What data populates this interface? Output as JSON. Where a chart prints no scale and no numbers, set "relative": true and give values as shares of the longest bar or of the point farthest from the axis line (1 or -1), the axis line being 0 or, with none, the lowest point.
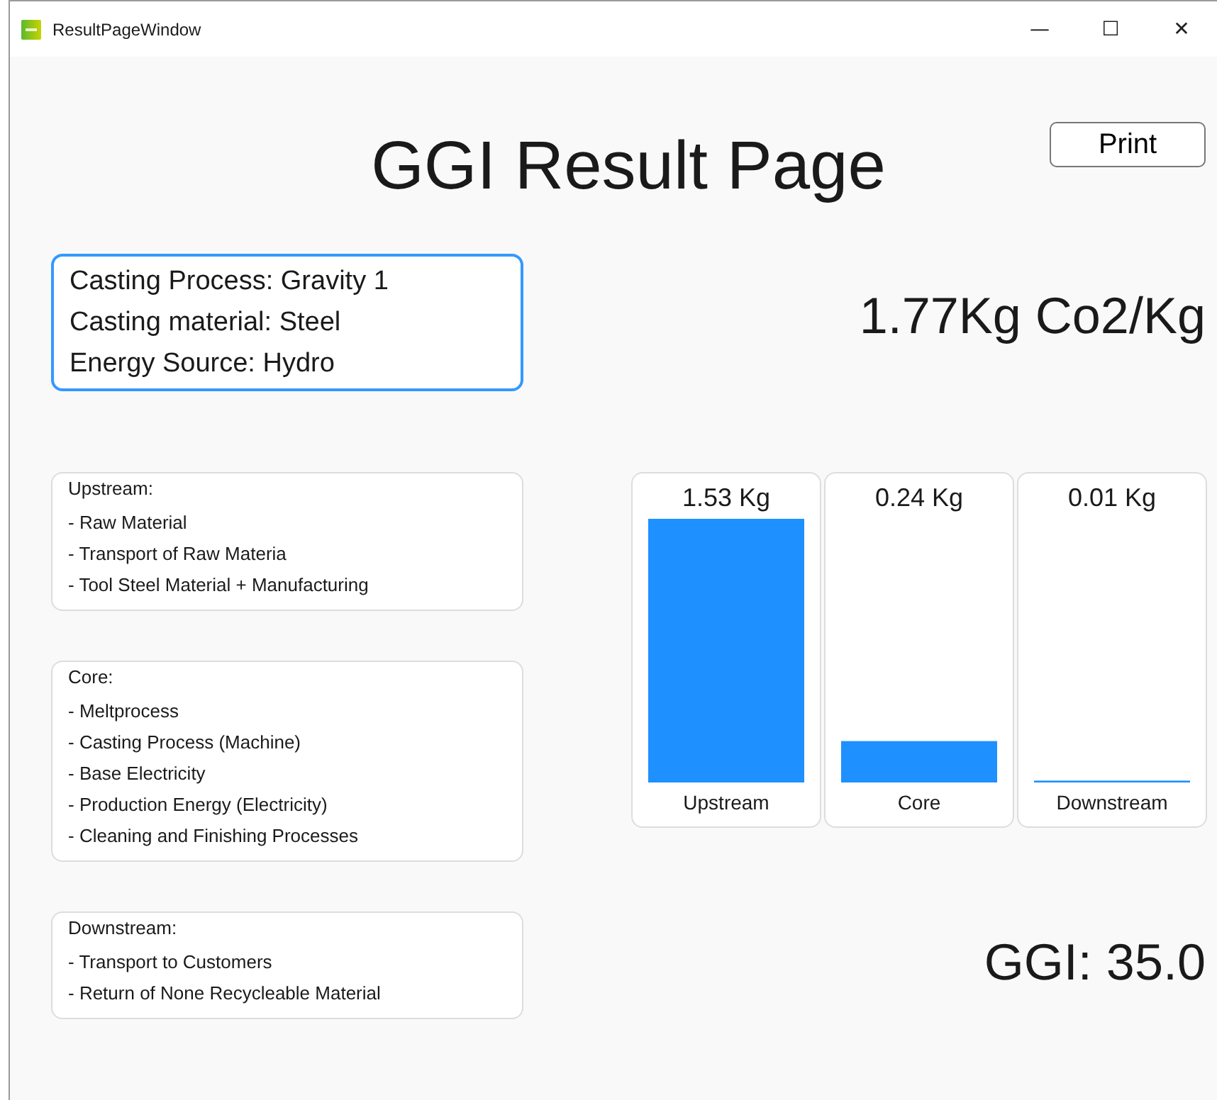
{
  "window": {
    "title": "ResultPageWindow",
    "controls": [
      "—",
      "☐",
      "✕"
    ]
  },
  "heading": "GGI Result Page",
  "print_button": "Print",
  "info": [
    "Casting Process: Gravity 1",
    "Casting material: Steel",
    "Energy Source: Hydro"
  ],
  "total": "1.77Kg Co2/Kg",
  "categories": [
    {
      "title": "Upstream:",
      "items": [
        "- Raw Material",
        "- Transport of Raw Materia",
        "- Tool Steel Material + Manufacturing"
      ]
    },
    {
      "title": "Core:",
      "items": [
        "- Meltprocess",
        "- Casting Process (Machine)",
        "- Base Electricity",
        "- Production Energy (Electricity)",
        "- Cleaning and Finishing Processes"
      ]
    },
    {
      "title": "Downstream:",
      "items": [
        "- Transport to Customers",
        "- Return of None Recycleable Material"
      ]
    }
  ],
  "emissions": {
    "readings": [
      "1.53 Kg",
      "0.24 Kg",
      "0.01 Kg"
    ],
    "chart_data": {
      "type": "bar",
      "categories": [
        "Upstream",
        "Core",
        "Downstream"
      ],
      "values": [
        1.0,
        0.157,
        0.007
      ],
      "relative": true
    }
  },
  "ggi": "GGI: 35.0"
}
